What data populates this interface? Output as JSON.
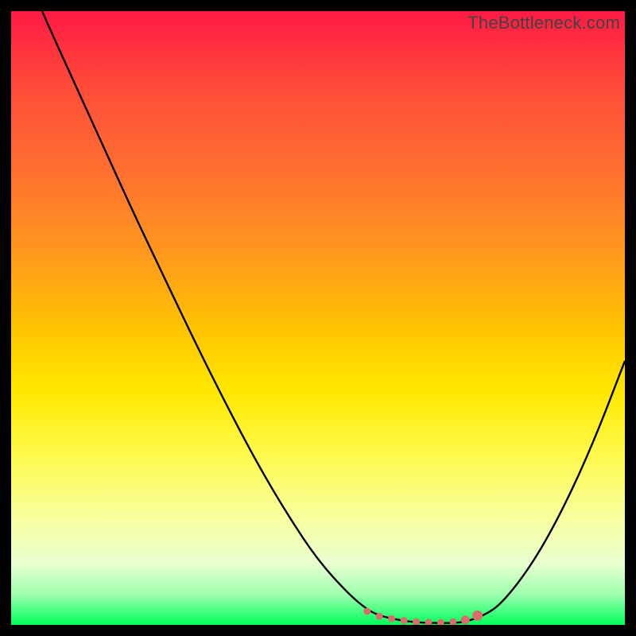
{
  "watermark": "TheBottleneck.com",
  "colors": {
    "curve_stroke": "#000000",
    "marker_fill": "#da6c6c",
    "marker_stroke": "#da6c6c"
  },
  "chart_data": {
    "type": "line",
    "title": "",
    "xlabel": "",
    "ylabel": "",
    "xlim": [
      0,
      100
    ],
    "ylim": [
      0,
      100
    ],
    "grid": false,
    "series": [
      {
        "name": "bottleneck-curve",
        "x": [
          0,
          5,
          10,
          15,
          20,
          25,
          30,
          35,
          40,
          45,
          50,
          55,
          58,
          60,
          63,
          66,
          69,
          72,
          74,
          77,
          80,
          85,
          90,
          95,
          100
        ],
        "values": [
          112,
          100,
          89,
          78,
          67,
          56.5,
          46,
          36,
          26.5,
          18,
          10.5,
          5,
          2.5,
          1.5,
          0.8,
          0.4,
          0.3,
          0.3,
          0.5,
          1.5,
          3.5,
          10,
          19,
          30,
          43
        ]
      }
    ],
    "markers": {
      "name": "highlight-dots",
      "x": [
        58,
        60,
        62,
        64,
        66,
        68,
        70,
        72,
        74,
        76
      ],
      "y": [
        2.2,
        1.4,
        1.0,
        0.7,
        0.5,
        0.4,
        0.4,
        0.5,
        0.8,
        1.5
      ],
      "radius": [
        4,
        4,
        4,
        4,
        4,
        4,
        4,
        4,
        5,
        6
      ]
    }
  }
}
